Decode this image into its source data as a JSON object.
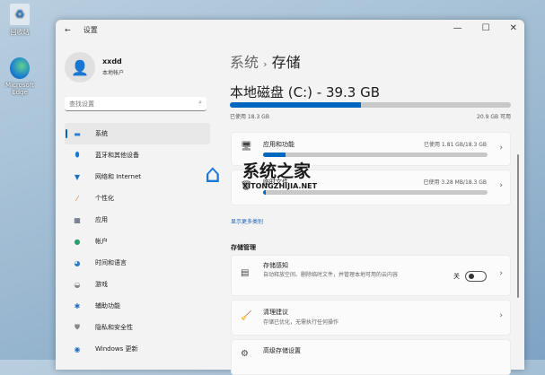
{
  "desktop": {
    "icons": [
      {
        "label": "回收站"
      },
      {
        "label": "Microsoft Edge"
      }
    ]
  },
  "window": {
    "title": "设置",
    "controls": [
      "—",
      "☐",
      "✕"
    ]
  },
  "user": {
    "name": "xxdd",
    "type": "本地帐户"
  },
  "search": {
    "placeholder": "查找设置"
  },
  "nav": [
    {
      "label": "系统",
      "icon": "▬",
      "color": "#2a7fd4"
    },
    {
      "label": "蓝牙和其他设备",
      "icon": "⬮",
      "color": "#0a78d7"
    },
    {
      "label": "网络和 Internet",
      "icon": "▼",
      "color": "#1a6fc9"
    },
    {
      "label": "个性化",
      "icon": "⁄",
      "color": "#d77a2a"
    },
    {
      "label": "应用",
      "icon": "▦",
      "color": "#4a5870"
    },
    {
      "label": "帐户",
      "icon": "●",
      "color": "#2aa06a"
    },
    {
      "label": "时间和语言",
      "icon": "◕",
      "color": "#2a7fd4"
    },
    {
      "label": "游戏",
      "icon": "◒",
      "color": "#888"
    },
    {
      "label": "辅助功能",
      "icon": "✱",
      "color": "#1a6fc9"
    },
    {
      "label": "隐私和安全性",
      "icon": "⛊",
      "color": "#888"
    },
    {
      "label": "Windows 更新",
      "icon": "◉",
      "color": "#1a6fc9"
    }
  ],
  "breadcrumb": {
    "parent": "系统",
    "sep": "›",
    "current": "存储"
  },
  "disk": {
    "title": "本地磁盘 (C:) - 39.3 GB",
    "used_label": "已使用 18.3 GB",
    "free_label": "20.9 GB 可用",
    "used_fraction": 0.466
  },
  "categories": [
    {
      "label": "应用和功能",
      "usage": "已使用 1.81 GB/18.3 GB",
      "fraction": 0.099
    },
    {
      "label": "临时文件",
      "usage": "已使用 3.28 MB/18.3 GB",
      "fraction": 0.002
    }
  ],
  "more_link": "显示更多类别",
  "management": {
    "heading": "存储管理",
    "items": [
      {
        "title": "存储感知",
        "desc": "自动释放空间、删除临时文件，并管理本地可用的云内容",
        "toggle_label": "关",
        "toggle_on": false
      },
      {
        "title": "清理建议",
        "desc": "存储已优化，无需执行任何操作"
      },
      {
        "title": "高级存储设置"
      }
    ]
  },
  "watermark": {
    "name": "系统之家",
    "url": "XITONGZHIJIA.NET"
  }
}
